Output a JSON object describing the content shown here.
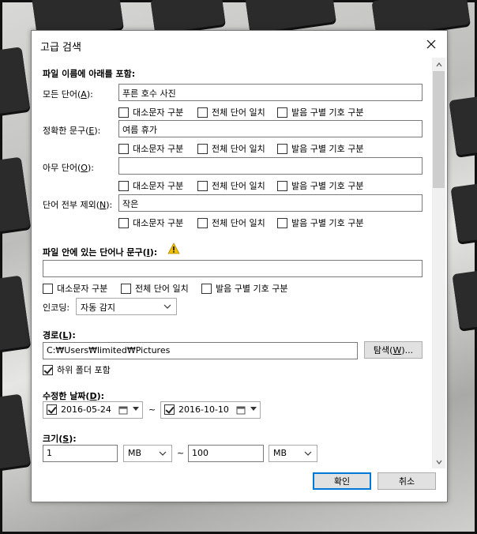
{
  "window": {
    "title": "고급 검색"
  },
  "filename_section": {
    "heading": "파일 이름에 아래를 포함:",
    "rows": [
      {
        "label": "모든 단어(",
        "key": "A",
        "tail": "):",
        "value": "푸른 호수 사진"
      },
      {
        "label": "정확한 문구(",
        "key": "E",
        "tail": "):",
        "value": "여름 휴가"
      },
      {
        "label": "아무 단어(",
        "key": "O",
        "tail": "):",
        "value": ""
      },
      {
        "label": "단어 전부 제외(",
        "key": "N",
        "tail": "):",
        "value": "작은"
      }
    ],
    "options": [
      "대소문자 구분",
      "전체 단어 일치",
      "발음 구별 기호 구분"
    ]
  },
  "content_section": {
    "heading": "파일 안에 있는 단어나 문구(",
    "key": "I",
    "tail": "):",
    "value": "",
    "options": [
      "대소문자 구분",
      "전체 단어 일치",
      "발음 구별 기호 구분"
    ],
    "encoding_label": "인코딩:",
    "encoding_value": "자동 감지"
  },
  "path_section": {
    "heading": "경로(",
    "key": "L",
    "tail": "):",
    "value": "C:₩Users₩limited₩Pictures",
    "browse_label": "탐색(",
    "browse_key": "W",
    "browse_tail": ")...",
    "subfolder_label": "하위 폴더 포함",
    "subfolder_checked": true
  },
  "date_section": {
    "heading": "수정한 날짜(",
    "key": "D",
    "tail": "):",
    "from": "2016-05-24",
    "to": "2016-10-10",
    "separator": "~"
  },
  "size_section": {
    "heading": "크기(",
    "key": "S",
    "tail": "):",
    "min_value": "1",
    "min_unit": "MB",
    "separator": "~",
    "max_value": "100",
    "max_unit": "MB"
  },
  "buttons": {
    "ok": "확인",
    "cancel": "취소"
  },
  "colors": {
    "accent": "#0078d7",
    "warning": "#f2c200"
  }
}
